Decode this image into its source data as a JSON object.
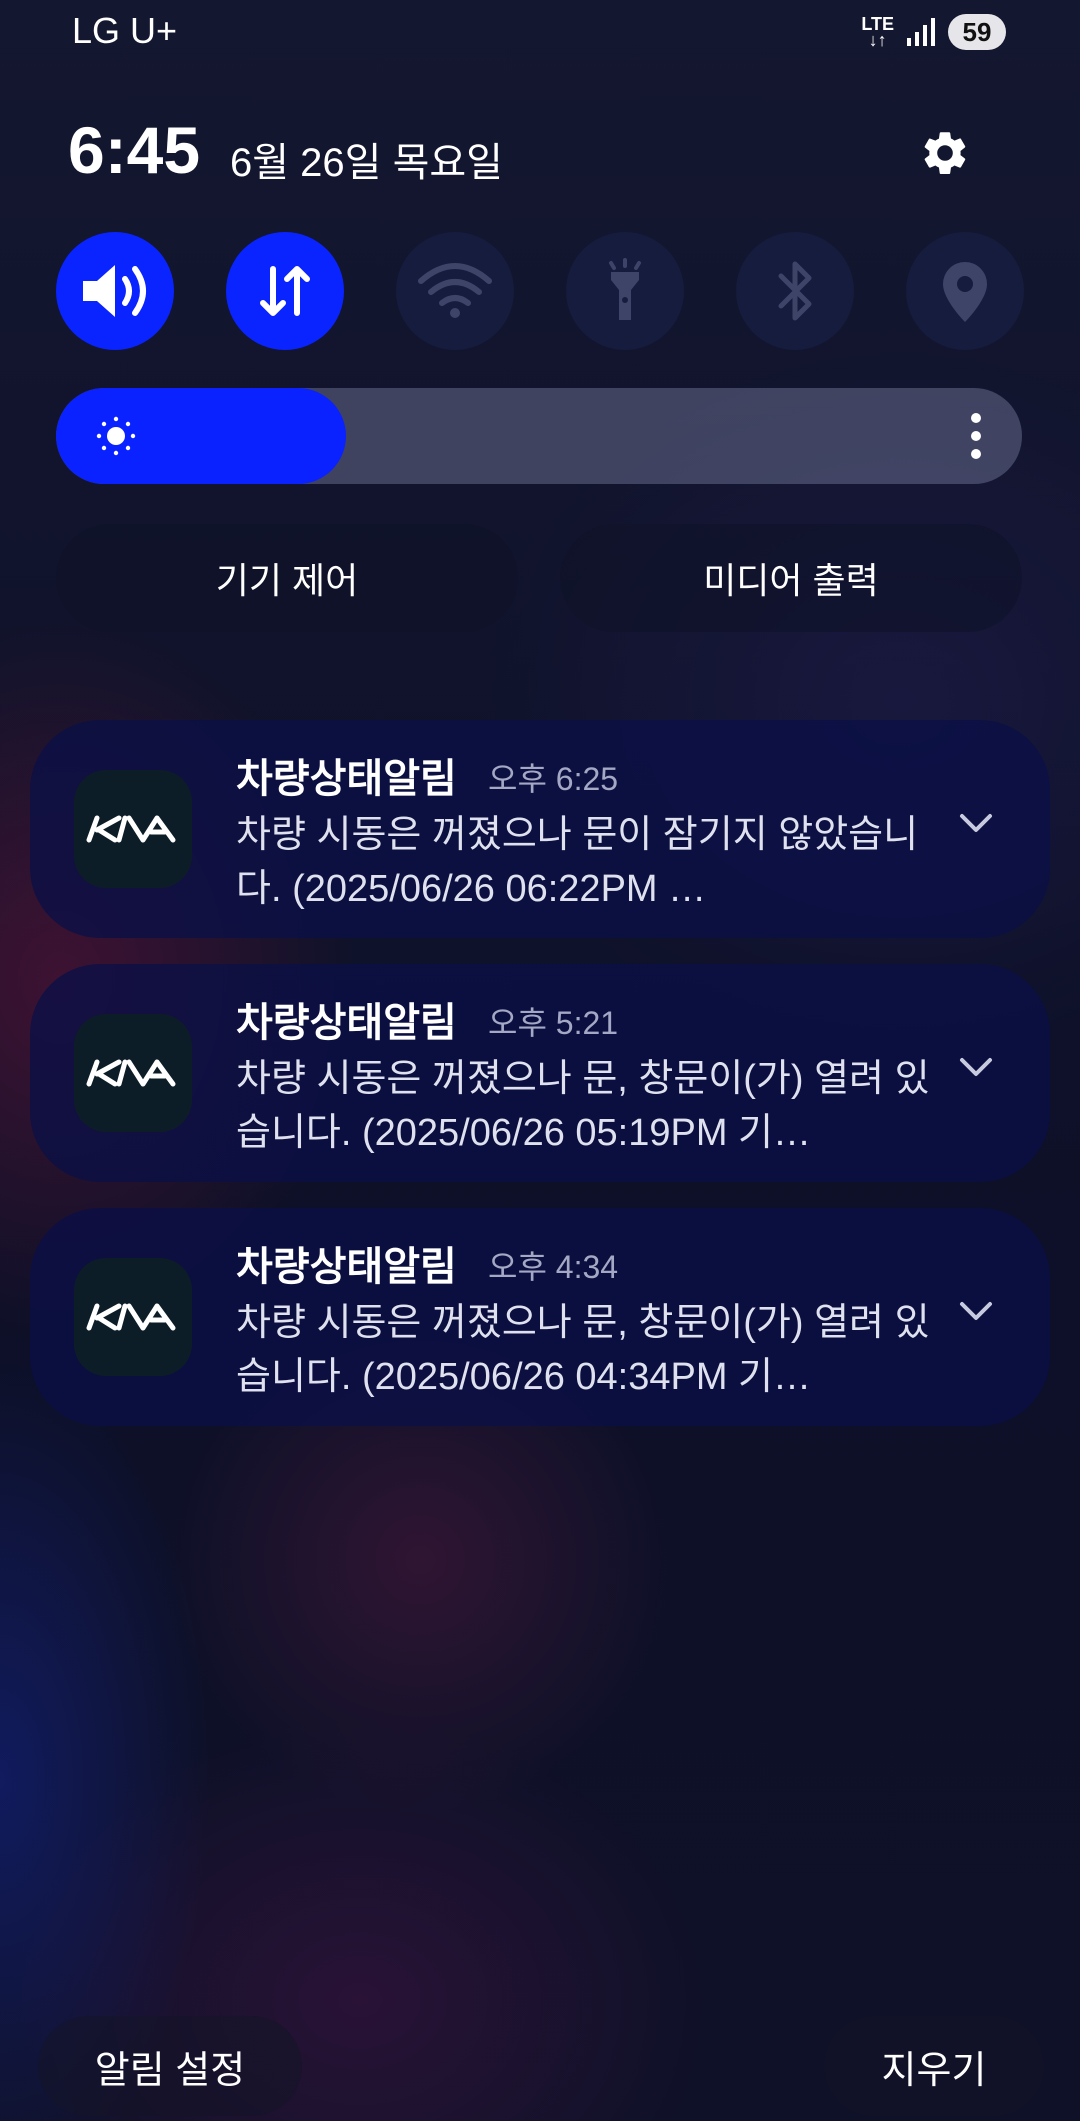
{
  "status_bar": {
    "carrier": "LG U+",
    "network_top": "LTE",
    "network_bottom": "↓↑",
    "battery": "59"
  },
  "header": {
    "time": "6:45",
    "date": "6월 26일 목요일",
    "settings_icon": "gear-icon"
  },
  "quick_tiles": [
    {
      "icon": "volume-icon",
      "active": true
    },
    {
      "icon": "mobile-data-icon",
      "active": true
    },
    {
      "icon": "wifi-icon",
      "active": false
    },
    {
      "icon": "flashlight-icon",
      "active": false
    },
    {
      "icon": "bluetooth-icon",
      "active": false
    },
    {
      "icon": "location-icon",
      "active": false
    }
  ],
  "brightness": {
    "level_fraction": 0.3,
    "icon": "sun-icon"
  },
  "controls": {
    "device_control": "기기 제어",
    "media_output": "미디어 출력"
  },
  "notifications": [
    {
      "app": "차량상태알림",
      "time": "오후 6:25",
      "body": "차량 시동은 꺼졌으나 문이 잠기지 않았습니다. (2025/06/26 06:22PM …"
    },
    {
      "app": "차량상태알림",
      "time": "오후 5:21",
      "body": "차량 시동은 꺼졌으나 문, 창문이(가) 열려 있습니다. (2025/06/26 05:19PM 기…"
    },
    {
      "app": "차량상태알림",
      "time": "오후 4:34",
      "body": "차량 시동은 꺼졌으나 문, 창문이(가) 열려 있습니다. (2025/06/26 04:34PM 기…"
    }
  ],
  "footer": {
    "notification_settings": "알림 설정",
    "clear": "지우기"
  }
}
